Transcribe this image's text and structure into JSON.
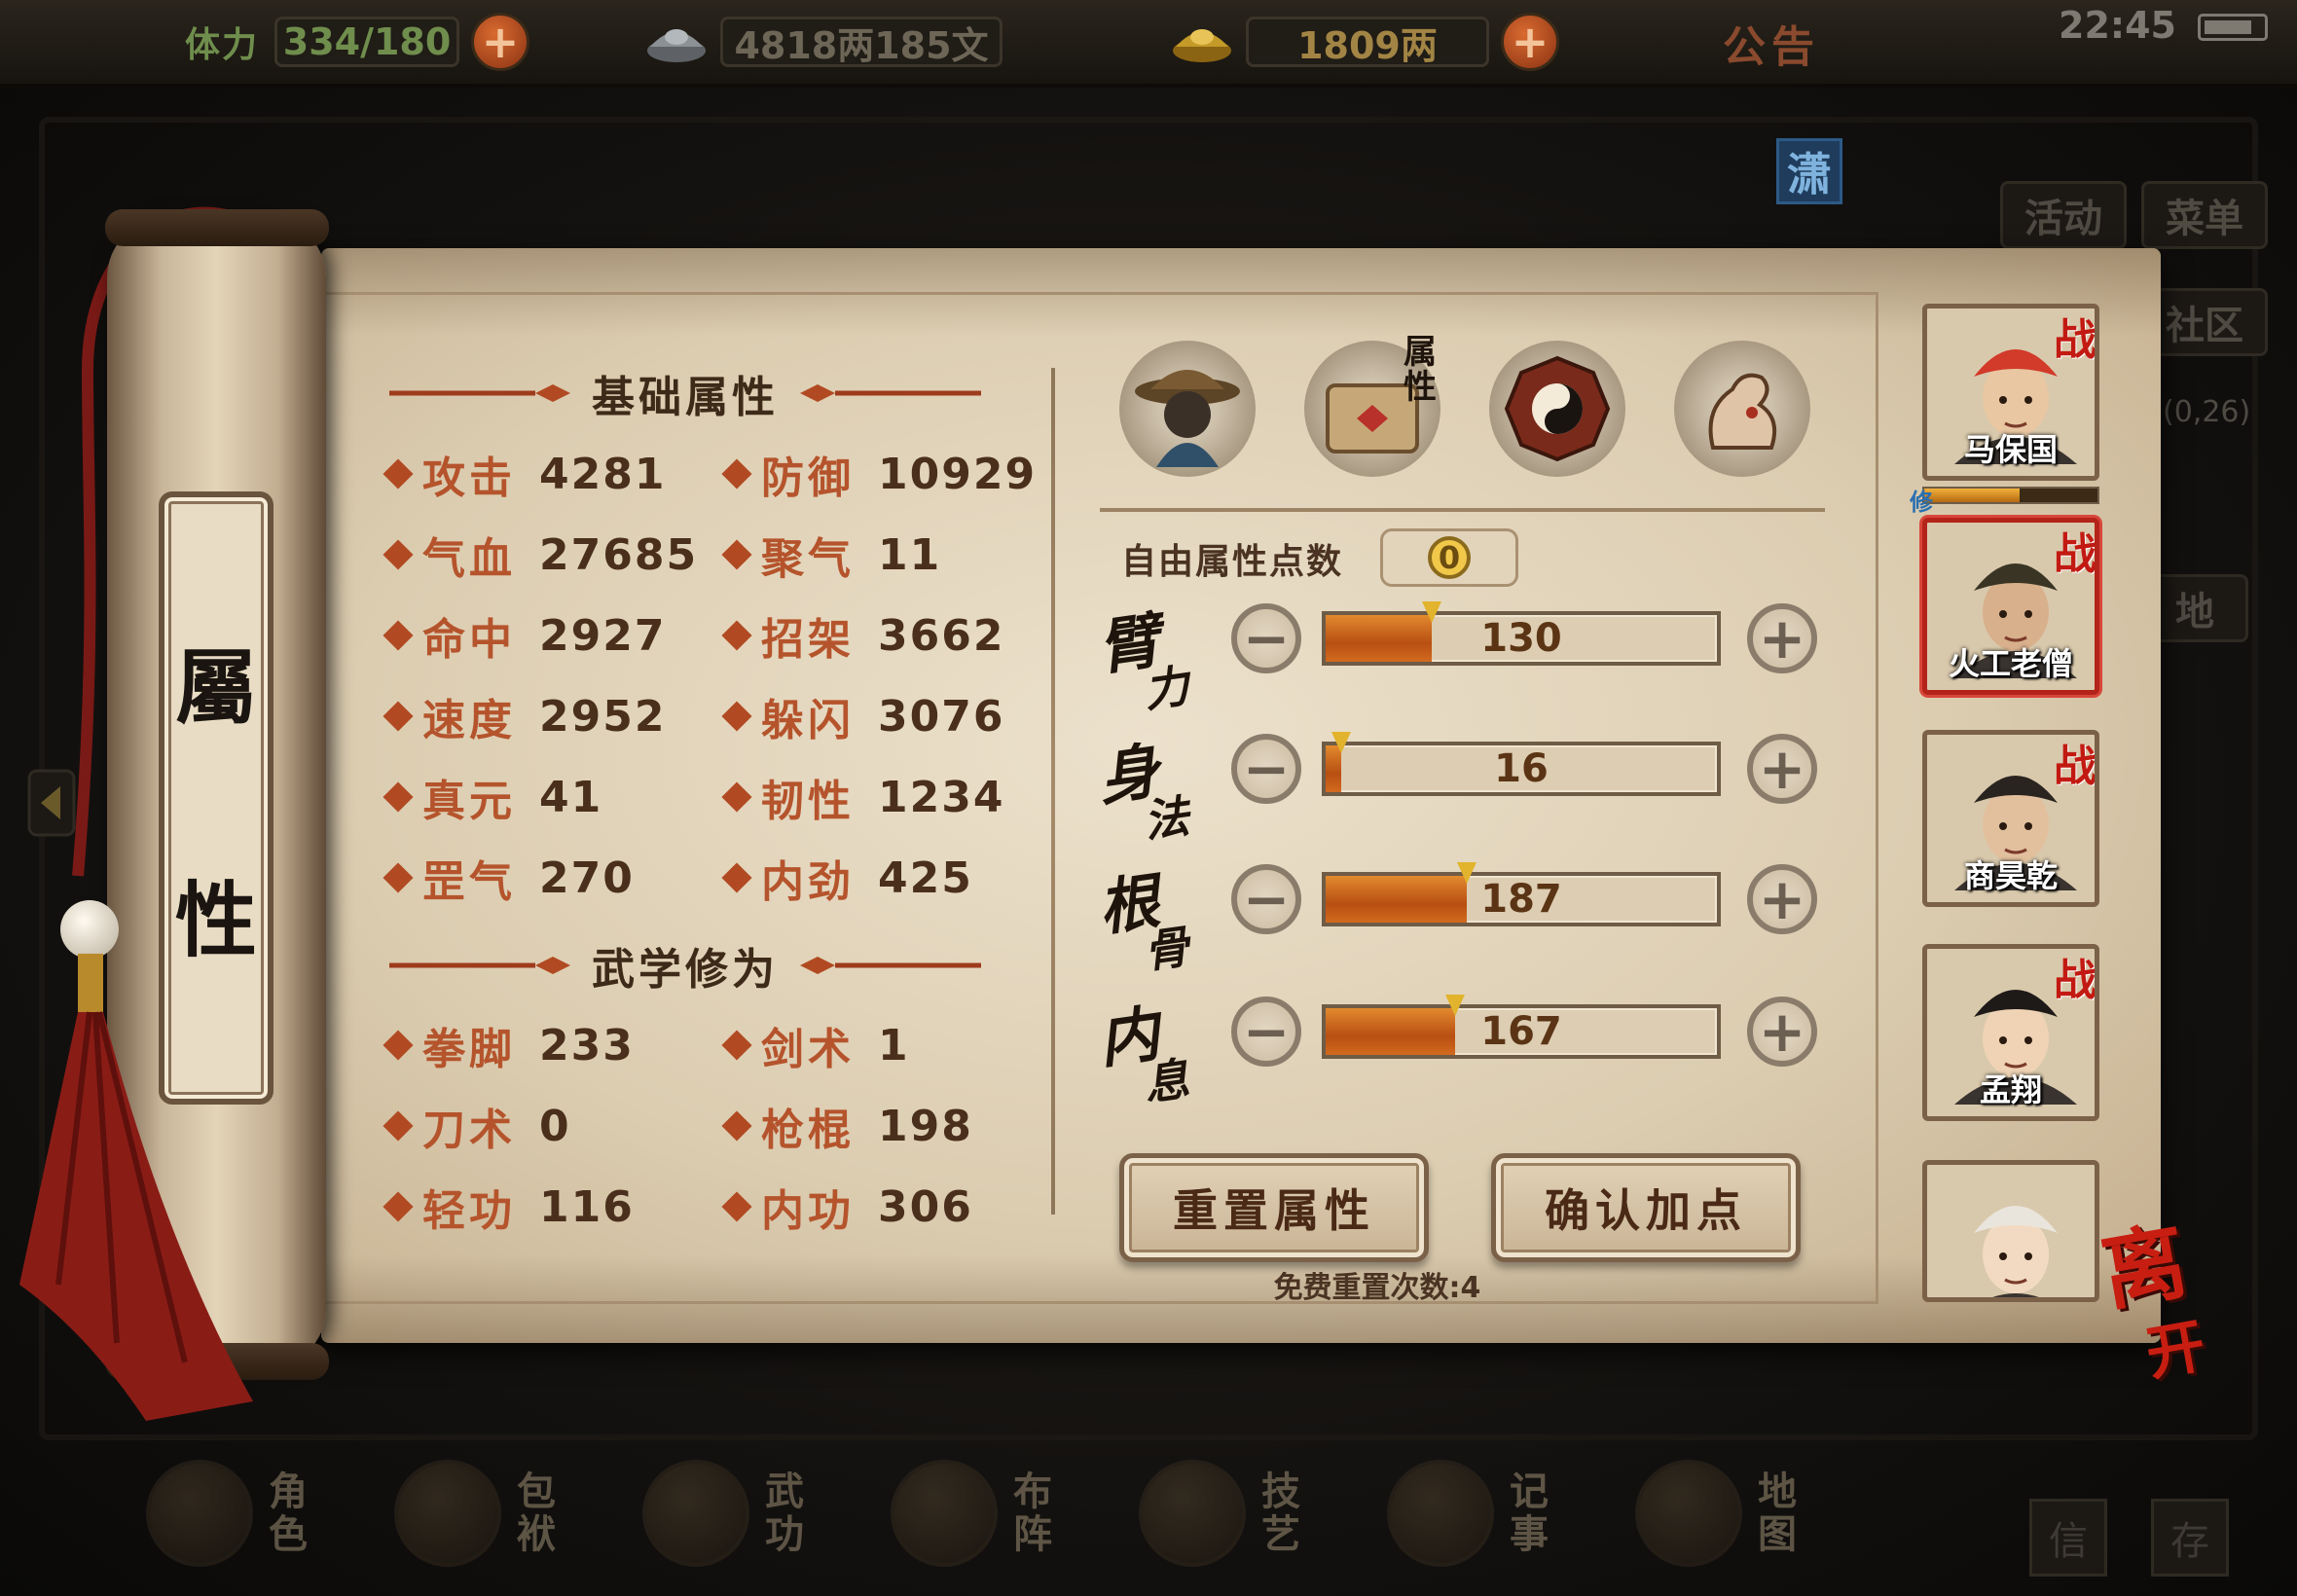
{
  "topbar": {
    "stamina_label": "体力",
    "stamina_value": "334/180",
    "silver": "4818两185文",
    "gold": "1809两",
    "notice": "公告",
    "time": "22:45"
  },
  "side_menu": {
    "activity": "活动",
    "menu": "菜单",
    "community": "社区",
    "coord": "(0,26)",
    "map_stub": "地",
    "badge": "潇"
  },
  "scroll": {
    "title_chars": [
      "屬",
      "性"
    ]
  },
  "basic_attrs": {
    "title": "基础属性",
    "stats": [
      {
        "name": "攻击",
        "value": "4281"
      },
      {
        "name": "防御",
        "value": "10929"
      },
      {
        "name": "气血",
        "value": "27685"
      },
      {
        "name": "聚气",
        "value": "11"
      },
      {
        "name": "命中",
        "value": "2927"
      },
      {
        "name": "招架",
        "value": "3662"
      },
      {
        "name": "速度",
        "value": "2952"
      },
      {
        "name": "躲闪",
        "value": "3076"
      },
      {
        "name": "真元",
        "value": "41"
      },
      {
        "name": "韧性",
        "value": "1234"
      },
      {
        "name": "罡气",
        "value": "270"
      },
      {
        "name": "内劲",
        "value": "425"
      }
    ]
  },
  "martial": {
    "title": "武学修为",
    "stats": [
      {
        "name": "拳脚",
        "value": "233"
      },
      {
        "name": "剑术",
        "value": "1"
      },
      {
        "name": "刀术",
        "value": "0"
      },
      {
        "name": "枪棍",
        "value": "198"
      },
      {
        "name": "轻功",
        "value": "116"
      },
      {
        "name": "内功",
        "value": "306"
      }
    ]
  },
  "tabs": [
    {
      "icon": "hero-icon",
      "label": ""
    },
    {
      "icon": "attribute-scroll-icon",
      "label": "属性"
    },
    {
      "icon": "bagua-icon",
      "label": ""
    },
    {
      "icon": "muscle-icon",
      "label": ""
    }
  ],
  "free_points": {
    "label": "自由属性点数",
    "value": "0"
  },
  "attributes": [
    {
      "label_main": "臂",
      "label_sub": "力",
      "value": "130",
      "fill": 0.27
    },
    {
      "label_main": "身",
      "label_sub": "法",
      "value": "16",
      "fill": 0.04
    },
    {
      "label_main": "根",
      "label_sub": "骨",
      "value": "187",
      "fill": 0.36
    },
    {
      "label_main": "内",
      "label_sub": "息",
      "value": "167",
      "fill": 0.33
    }
  ],
  "buttons": {
    "reset": "重置属性",
    "confirm": "确认加点",
    "minus": "⊖",
    "plus": "⊕"
  },
  "reset_note": "免费重置次数:4",
  "characters": [
    {
      "name": "马保国",
      "tag": "战",
      "skin": "#e8c7a2",
      "hat": "#d23a2a"
    },
    {
      "name": "火工老僧",
      "tag": "战",
      "skin": "#d8b08c",
      "hat": "#3a3424"
    },
    {
      "name": "商昊乾",
      "tag": "战",
      "skin": "#e2c09e",
      "hat": "#2a2420"
    },
    {
      "name": "孟翔",
      "tag": "战",
      "skin": "#efd3b4",
      "hat": "#1e1a18"
    },
    {
      "name": "",
      "tag": "",
      "skin": "#f2dac2",
      "hat": "#e9e5dc"
    }
  ],
  "xiu_tag": "修",
  "xiu_fill": 0.55,
  "leave": {
    "main": "离",
    "sub": "开"
  },
  "bottom_nav": [
    {
      "label": "角色"
    },
    {
      "label": "包袱"
    },
    {
      "label": "武功"
    },
    {
      "label": "布阵"
    },
    {
      "label": "技艺"
    },
    {
      "label": "记事"
    },
    {
      "label": "地图"
    }
  ],
  "bottom_right": [
    "信",
    "存"
  ],
  "colors": {
    "accent": "#b5542c",
    "bar_fill": "#d26a1e",
    "battle_tag": "#c21a12"
  }
}
